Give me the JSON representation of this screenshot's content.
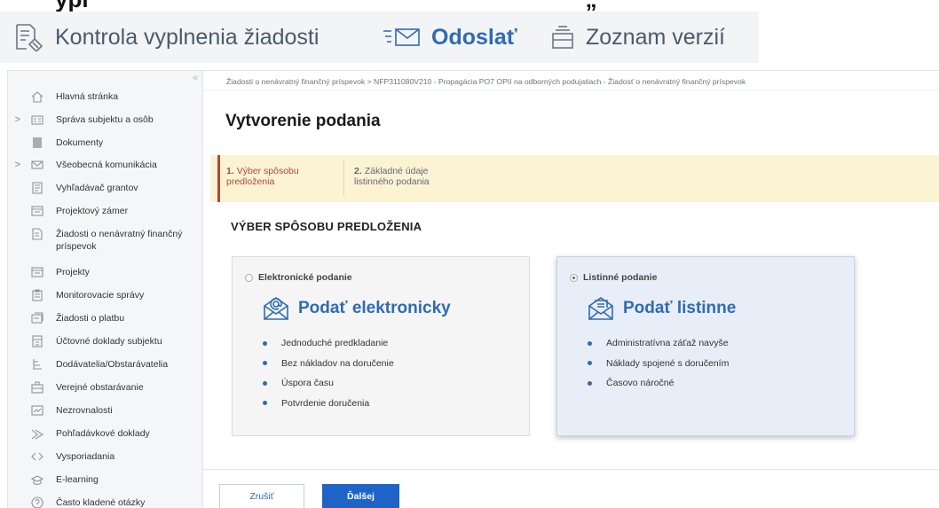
{
  "toolbar": {
    "cut_title": "ypl",
    "cut_tail": "„",
    "items": [
      {
        "label": "Kontrola vyplnenia žiadosti",
        "icon": "form-check-icon"
      },
      {
        "label": "Odoslať",
        "icon": "send-mail-icon"
      },
      {
        "label": "Zoznam verzií",
        "icon": "versions-icon"
      }
    ]
  },
  "sidebar": {
    "collapse": "«",
    "items": [
      {
        "label": "Hlavná stránka",
        "icon": "home-icon",
        "caret": ""
      },
      {
        "label": "Správa subjektu a osôb",
        "icon": "id-card-icon",
        "caret": ">"
      },
      {
        "label": "Dokumenty",
        "icon": "document-icon",
        "caret": ""
      },
      {
        "label": "Všeobecná komunikácia",
        "icon": "envelope-icon",
        "caret": ">"
      },
      {
        "label": "Vyhľadávač grantov",
        "icon": "search-list-icon",
        "caret": ""
      },
      {
        "label": "Projektový zámer",
        "icon": "folder-icon",
        "caret": ""
      },
      {
        "label": "Žiadosti o nenávratný finančný príspevok",
        "icon": "application-icon",
        "caret": ""
      },
      {
        "label": "Projekty",
        "icon": "projects-icon",
        "caret": ""
      },
      {
        "label": "Monitorovacie správy",
        "icon": "clipboard-icon",
        "caret": ""
      },
      {
        "label": "Žiadosti o platbu",
        "icon": "payment-icon",
        "caret": ""
      },
      {
        "label": "Účtovné doklady subjektu",
        "icon": "ledger-icon",
        "caret": ""
      },
      {
        "label": "Dodávatelia/Obstarávatelia",
        "icon": "supplier-icon",
        "caret": ""
      },
      {
        "label": "Verejné obstarávanie",
        "icon": "procurement-icon",
        "caret": ""
      },
      {
        "label": "Nezrovnalosti",
        "icon": "irregularity-icon",
        "caret": ""
      },
      {
        "label": "Pohľadávkové doklady",
        "icon": "receivables-icon",
        "caret": ""
      },
      {
        "label": "Vysporiadania",
        "icon": "settlement-icon",
        "caret": ""
      },
      {
        "label": "E-learning",
        "icon": "graduation-cap-icon",
        "caret": ""
      },
      {
        "label": "Často kladené otázky",
        "icon": "question-icon",
        "caret": ""
      }
    ]
  },
  "breadcrumb": "Žiadosti o nenávratný finančný príspevok  >  NFP311080V210 - Propagácia PO7 OPII na odborných podujatiach - Žiadosť o nenávratný finančný príspevok",
  "page_title": "Vytvorenie podania",
  "steps": [
    {
      "num": "1.",
      "text": "Výber spôsobu",
      "text2": "predloženia"
    },
    {
      "num": "2.",
      "text": "Základné údaje",
      "text2": "listinného podania"
    }
  ],
  "section_title": "VÝBER SPÔSOBU PREDLOŽENIA",
  "cards": {
    "electronic": {
      "radio_label": "Elektronické podanie",
      "selected": false,
      "heading": "Podať elektronicky",
      "icon": "email-at-icon",
      "bullets": [
        "Jednoduché predkladanie",
        "Bez nákladov na doručenie",
        "Úspora času",
        "Potvrdenie doručenia"
      ]
    },
    "paper": {
      "radio_label": "Listinné podanie",
      "selected": true,
      "heading": "Podať listinne",
      "icon": "letter-icon",
      "bullets": [
        "Administratívna záťaž navyše",
        "Náklady spojené s doručením",
        "Časovo náročné"
      ]
    }
  },
  "buttons": {
    "cancel": "Zrušiť",
    "next": "Ďalšej"
  },
  "colors": {
    "accent": "#2f6bb3",
    "step_active": "#b0473a",
    "stepper_bg": "#fcf3d3",
    "primary_button": "#1e64c8"
  }
}
